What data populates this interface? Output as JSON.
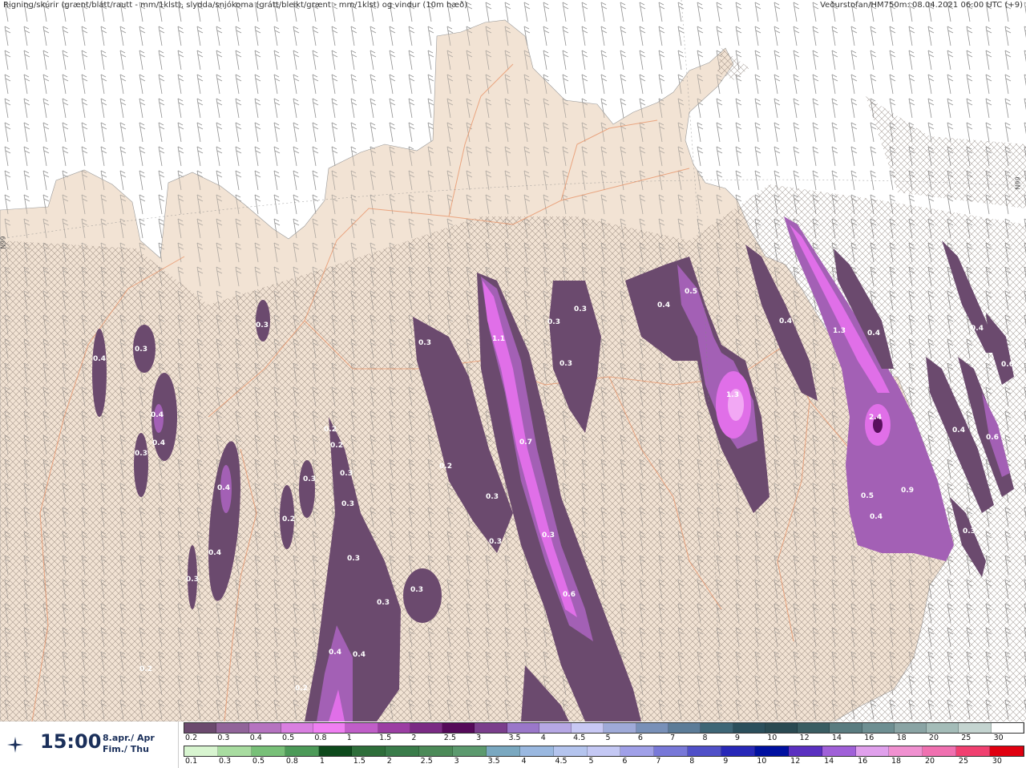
{
  "header": {
    "title": "Rigning/skúrir (grænt/blátt/rautt - mm/1klst), slydda/snjókoma (grátt/bleikt/grænt - mm/1klst) og vindur (10m hæð)",
    "source": "Veðurstofan/HM750m: 08.04.2021 06:00 UTC (+9)"
  },
  "grid_labels": {
    "left": "N99",
    "right": "N99"
  },
  "time_panel": {
    "time": "15:00",
    "date_line1": "8.apr./ Apr",
    "date_line2": "Fim./ Thu",
    "icon": "compass-star-icon"
  },
  "colors": {
    "land": "#f2e3d4",
    "sea": "#ffffff",
    "roads": "#e8956a",
    "precip_light": "#6b4a6e",
    "precip_mid": "#a360b5",
    "precip_heavy": "#e06fe8",
    "precip_peak": "#5a0f5e"
  },
  "legend_snow": {
    "labels": [
      "0.2",
      "0.3",
      "0.4",
      "0.5",
      "0.8",
      "1",
      "1.5",
      "2",
      "2.5",
      "3",
      "3.5",
      "4",
      "4.5",
      "5",
      "6",
      "7",
      "8",
      "9",
      "10",
      "12",
      "14",
      "16",
      "18",
      "20",
      "25",
      "30"
    ],
    "colors": [
      "#6b4a6e",
      "#91649a",
      "#b573c0",
      "#d97fe0",
      "#f07ff2",
      "#c05ec8",
      "#9b3ea3",
      "#7a2a84",
      "#550a5a",
      "#7a3e8c",
      "#9a77c9",
      "#b6a7e4",
      "#c8c8f4",
      "#9faad8",
      "#7890b8",
      "#5c7c98",
      "#3e6676",
      "#2b4f5c",
      "#2a4a52",
      "#3a5d62",
      "#5a7c80",
      "#6e8f92",
      "#8aa4a4",
      "#a4bcb8",
      "#c4d4d0",
      "#ffffff"
    ]
  },
  "legend_rain": {
    "labels": [
      "0.1",
      "0.3",
      "0.5",
      "0.8",
      "1",
      "1.5",
      "2",
      "2.5",
      "3",
      "3.5",
      "4",
      "4.5",
      "5",
      "6",
      "7",
      "8",
      "9",
      "10",
      "12",
      "14",
      "16",
      "18",
      "20",
      "25",
      "30"
    ],
    "colors": [
      "#d8f5d0",
      "#a8dca0",
      "#78c078",
      "#4c9a58",
      "#0e4a1c",
      "#2e6e3a",
      "#3a7c4a",
      "#4c8a58",
      "#5c9a6e",
      "#7aa8c0",
      "#9ab8e0",
      "#b4c4ee",
      "#c4c8f4",
      "#a0a0e8",
      "#7878d8",
      "#5050c8",
      "#2828b8",
      "#0010a0",
      "#5a30c0",
      "#a060d8",
      "#e0a0ec",
      "#f090d0",
      "#f070b0",
      "#f04070",
      "#e00010"
    ]
  },
  "map_values": [
    {
      "label": "0.4"
    },
    {
      "label": "0.3"
    },
    {
      "label": "0.4"
    },
    {
      "label": "0.4"
    },
    {
      "label": "0.3"
    },
    {
      "label": "0.4"
    },
    {
      "label": "0.3"
    },
    {
      "label": "0.2"
    },
    {
      "label": "0.4"
    },
    {
      "label": "0.3"
    },
    {
      "label": "0.2"
    },
    {
      "label": "0.2"
    },
    {
      "label": "0.3"
    },
    {
      "label": "0.3"
    },
    {
      "label": "0.3"
    },
    {
      "label": "0.3"
    },
    {
      "label": "0.4"
    },
    {
      "label": "0.4"
    },
    {
      "label": "0.3"
    },
    {
      "label": "0.3"
    },
    {
      "label": "0.2"
    },
    {
      "label": "0.3"
    },
    {
      "label": "1.1"
    },
    {
      "label": "0.7"
    },
    {
      "label": "0.3"
    },
    {
      "label": "0.3"
    },
    {
      "label": "0.6"
    },
    {
      "label": "0.3"
    },
    {
      "label": "0.3"
    },
    {
      "label": "0.3"
    },
    {
      "label": "0.4"
    },
    {
      "label": "0.5"
    },
    {
      "label": "1.3"
    },
    {
      "label": "0.3"
    },
    {
      "label": "0.4"
    },
    {
      "label": "1.3"
    },
    {
      "label": "0.4"
    },
    {
      "label": "2.4"
    },
    {
      "label": "0.9"
    },
    {
      "label": "0.5"
    },
    {
      "label": "0.4"
    },
    {
      "label": "0.4"
    },
    {
      "label": "0.6"
    },
    {
      "label": "0.4"
    },
    {
      "label": "0.6"
    },
    {
      "label": "0.3"
    },
    {
      "label": "0.2"
    },
    {
      "label": "0.2"
    }
  ]
}
